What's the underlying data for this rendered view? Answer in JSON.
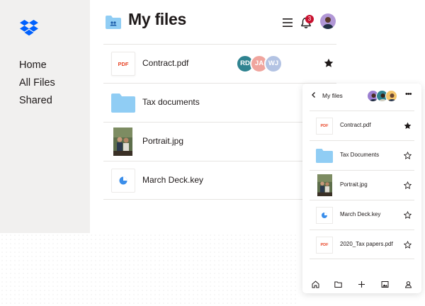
{
  "colors": {
    "brand": "#0061fe",
    "folder": "#90cdf4",
    "pdf": "#e8472a",
    "badge": "#c8102e",
    "sidebar_bg": "#f1f0ef"
  },
  "sidebar": {
    "logo_icon": "dropbox-logo",
    "items": [
      {
        "label": "Home"
      },
      {
        "label": "All Files"
      },
      {
        "label": "Shared"
      }
    ]
  },
  "header": {
    "title": "My files",
    "notification_count": "3"
  },
  "files": [
    {
      "name": "Contract.pdf",
      "type": "pdf",
      "thumb_label": "PDF",
      "starred": true,
      "shared_with": [
        {
          "initials": "RD",
          "color": "#2f8390"
        },
        {
          "initials": "JA",
          "color": "#f0a59e"
        },
        {
          "initials": "WJ",
          "color": "#b3c3e3"
        }
      ]
    },
    {
      "name": "Tax documents",
      "type": "folder"
    },
    {
      "name": "Portrait.jpg",
      "type": "image"
    },
    {
      "name": "March Deck.key",
      "type": "keynote"
    }
  ],
  "mobile": {
    "title": "My files",
    "files": [
      {
        "name": "Contract.pdf",
        "type": "pdf",
        "thumb_label": "PDF",
        "starred": true
      },
      {
        "name": "Tax Documents",
        "type": "folder",
        "starred": false
      },
      {
        "name": "Portrait.jpg",
        "type": "image",
        "starred": false
      },
      {
        "name": "March Deck.key",
        "type": "keynote",
        "starred": false
      },
      {
        "name": "2020_Tax papers.pdf",
        "type": "pdf",
        "thumb_label": "PDF",
        "starred": false
      }
    ],
    "tabs": [
      "home-icon",
      "folder-icon",
      "plus-icon",
      "photos-icon",
      "account-icon"
    ]
  }
}
